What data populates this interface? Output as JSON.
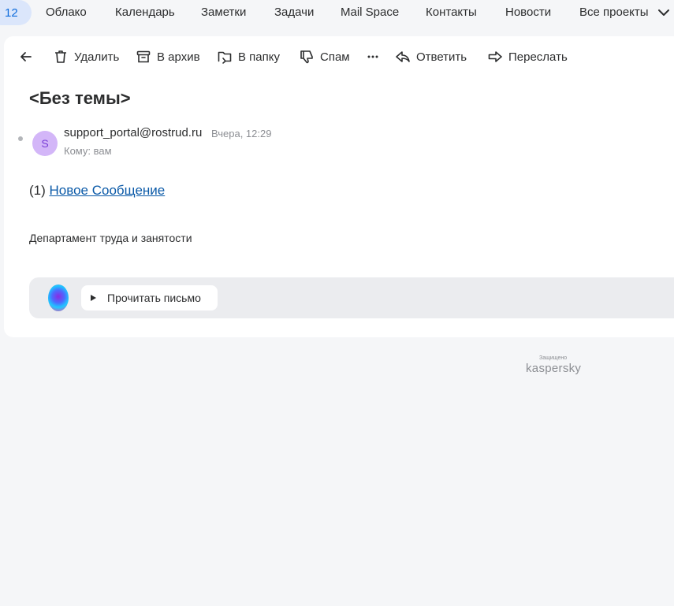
{
  "topnav": {
    "active_count": "12",
    "items": [
      "Облако",
      "Календарь",
      "Заметки",
      "Задачи",
      "Mail Space",
      "Контакты",
      "Новости",
      "Все проекты"
    ]
  },
  "toolbar": {
    "delete": "Удалить",
    "archive": "В архив",
    "to_folder": "В папку",
    "spam": "Спам",
    "reply": "Ответить",
    "forward": "Переслать"
  },
  "letter": {
    "subject": "<Без темы>",
    "sender_initial": "S",
    "sender": "support_portal@rostrud.ru",
    "date": "Вчера, 12:29",
    "recipient": "Кому: вам",
    "body_prefix": "(1)",
    "body_link": "Новое Сообщение",
    "body_text": "Департамент труда и занятости"
  },
  "assistant": {
    "read_label": "Прочитать письмо"
  },
  "security": {
    "caption": "Защищено",
    "brand": "kaspersky"
  },
  "colors": {
    "accent": "#0d6bdc",
    "link": "#0b5aa8",
    "avatar_bg": "#d3b6f8",
    "page_bg": "#f5f6f8"
  }
}
